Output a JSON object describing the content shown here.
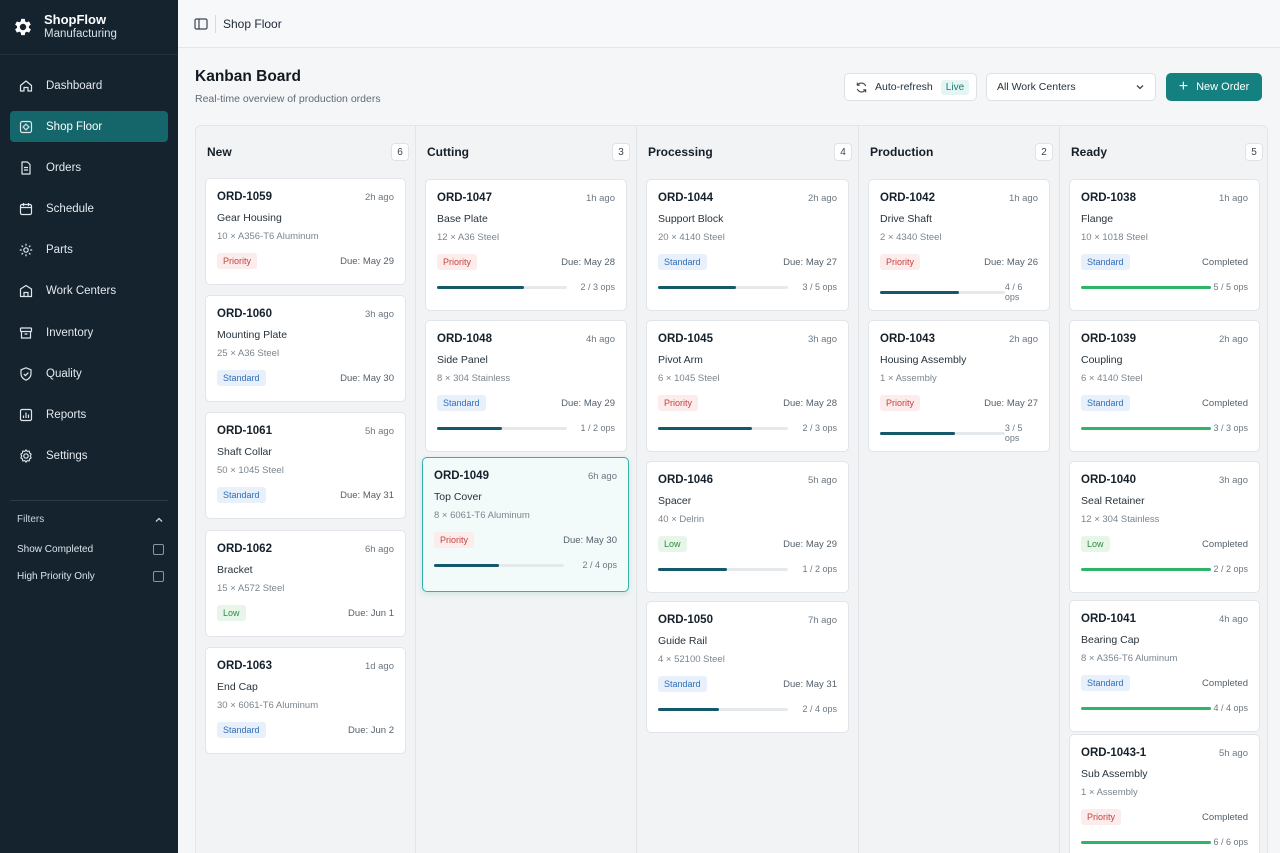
{
  "brand": {
    "name": "ShopFlow",
    "sub": "Manufacturing"
  },
  "nav": [
    {
      "label": "Dashboard",
      "icon": "home-icon"
    },
    {
      "label": "Shop Floor",
      "icon": "factory-icon",
      "active": true
    },
    {
      "label": "Orders",
      "icon": "document-icon"
    },
    {
      "label": "Schedule",
      "icon": "calendar-icon"
    },
    {
      "label": "Parts",
      "icon": "gear-icon"
    },
    {
      "label": "Work Centers",
      "icon": "building-icon"
    },
    {
      "label": "Inventory",
      "icon": "box-icon"
    },
    {
      "label": "Quality",
      "icon": "shield-icon"
    },
    {
      "label": "Reports",
      "icon": "chart-icon"
    },
    {
      "label": "Settings",
      "icon": "settings-icon"
    }
  ],
  "filters": {
    "title": "Filters",
    "options": [
      "Show Completed",
      "High Priority Only"
    ]
  },
  "breadcrumb": "Shop Floor",
  "page": {
    "title": "Kanban Board",
    "subtitle": "Real-time overview of production orders"
  },
  "toolbar": {
    "refresh_label": "Auto-refresh",
    "live_label": "Live",
    "work_center_value": "All Work Centers",
    "new_order_label": "New Order"
  },
  "colors": {
    "sidebar": "#15232f",
    "accent": "#14807f",
    "priority": "#c4433f",
    "standard": "#2f6fb8",
    "low": "#2f8a43",
    "complete": "#2fb56a"
  },
  "columns": [
    {
      "title": "New",
      "count": "6",
      "cards": [
        {
          "id": "ORD-1059",
          "time": "2h ago",
          "name": "Gear Housing",
          "material": "10 × A356-T6 Aluminum",
          "badge": "Priority",
          "due": "Due: May 29"
        },
        {
          "id": "ORD-1060",
          "time": "3h ago",
          "name": "Mounting Plate",
          "material": "25 × A36 Steel",
          "badge": "Standard",
          "due": "Due: May 30"
        },
        {
          "id": "ORD-1061",
          "time": "5h ago",
          "name": "Shaft Collar",
          "material": "50 × 1045 Steel",
          "badge": "Standard",
          "due": "Due: May 31"
        },
        {
          "id": "ORD-1062",
          "time": "6h ago",
          "name": "Bracket",
          "material": "15 × A572 Steel",
          "badge": "Low",
          "due": "Due: Jun 1"
        },
        {
          "id": "ORD-1063",
          "time": "1d ago",
          "name": "End Cap",
          "material": "30 × 6061-T6 Aluminum",
          "badge": "Standard",
          "due": "Due: Jun 2"
        }
      ]
    },
    {
      "title": "Cutting",
      "count": "3",
      "cards": [
        {
          "id": "ORD-1047",
          "time": "1h ago",
          "name": "Base Plate",
          "material": "12 × A36 Steel",
          "badge": "Priority",
          "due": "Due: May 28",
          "ops": "2 / 3 ops",
          "progress": 0.67
        },
        {
          "id": "ORD-1048",
          "time": "4h ago",
          "name": "Side Panel",
          "material": "8 × 304 Stainless",
          "badge": "Standard",
          "due": "Due: May 29",
          "ops": "1 / 2 ops",
          "progress": 0.5
        },
        {
          "id": "ORD-1049",
          "time": "6h ago",
          "name": "Top Cover",
          "material": "8 × 6061-T6 Aluminum",
          "badge": "Priority",
          "due": "Due: May 30",
          "ops": "2 / 4 ops",
          "progress": 0.5,
          "selected": true
        }
      ]
    },
    {
      "title": "Processing",
      "count": "4",
      "cards": [
        {
          "id": "ORD-1044",
          "time": "2h ago",
          "name": "Support Block",
          "material": "20 × 4140 Steel",
          "badge": "Standard",
          "due": "Due: May 27",
          "ops": "3 / 5 ops",
          "progress": 0.6
        },
        {
          "id": "ORD-1045",
          "time": "3h ago",
          "name": "Pivot Arm",
          "material": "6 × 1045 Steel",
          "badge": "Priority",
          "due": "Due: May 28",
          "ops": "2 / 3 ops",
          "progress": 0.72
        },
        {
          "id": "ORD-1046",
          "time": "5h ago",
          "name": "Spacer",
          "material": "40 × Delrin",
          "badge": "Low",
          "due": "Due: May 29",
          "ops": "1 / 2 ops",
          "progress": 0.53
        },
        {
          "id": "ORD-1050",
          "time": "7h ago",
          "name": "Guide Rail",
          "material": "4 × 52100 Steel",
          "badge": "Standard",
          "due": "Due: May 31",
          "ops": "2 / 4 ops",
          "progress": 0.47
        }
      ]
    },
    {
      "title": "Production",
      "count": "2",
      "cards": [
        {
          "id": "ORD-1042",
          "time": "1h ago",
          "name": "Drive Shaft",
          "material": "2 × 4340 Steel",
          "badge": "Priority",
          "due": "Due: May 26",
          "ops": "4 / 6 ops",
          "progress": 0.63
        },
        {
          "id": "ORD-1043",
          "time": "2h ago",
          "name": "Housing Assembly",
          "material": "1 × Assembly",
          "badge": "Priority",
          "due": "Due: May 27",
          "ops": "3 / 5 ops",
          "progress": 0.6
        }
      ]
    },
    {
      "title": "Ready",
      "count": "5",
      "cards": [
        {
          "id": "ORD-1038",
          "time": "1h ago",
          "name": "Flange",
          "material": "10 × 1018 Steel",
          "badge": "Standard",
          "due": "Completed",
          "ops": "5 / 5 ops",
          "progress": 1,
          "done": true
        },
        {
          "id": "ORD-1039",
          "time": "2h ago",
          "name": "Coupling",
          "material": "6 × 4140 Steel",
          "badge": "Standard",
          "due": "Completed",
          "ops": "3 / 3 ops",
          "progress": 1,
          "done": true
        },
        {
          "id": "ORD-1040",
          "time": "3h ago",
          "name": "Seal Retainer",
          "material": "12 × 304 Stainless",
          "badge": "Low",
          "due": "Completed",
          "ops": "2 / 2 ops",
          "progress": 1,
          "done": true
        },
        {
          "id": "ORD-1041",
          "time": "4h ago",
          "name": "Bearing Cap",
          "material": "8 × A356-T6 Aluminum",
          "badge": "Standard",
          "due": "Completed",
          "ops": "4 / 4 ops",
          "progress": 1,
          "done": true
        },
        {
          "id": "ORD-1043-1",
          "time": "5h ago",
          "name": "Sub Assembly",
          "material": "1 × Assembly",
          "badge": "Priority",
          "due": "Completed",
          "ops": "6 / 6 ops",
          "progress": 1,
          "done": true
        }
      ]
    }
  ]
}
